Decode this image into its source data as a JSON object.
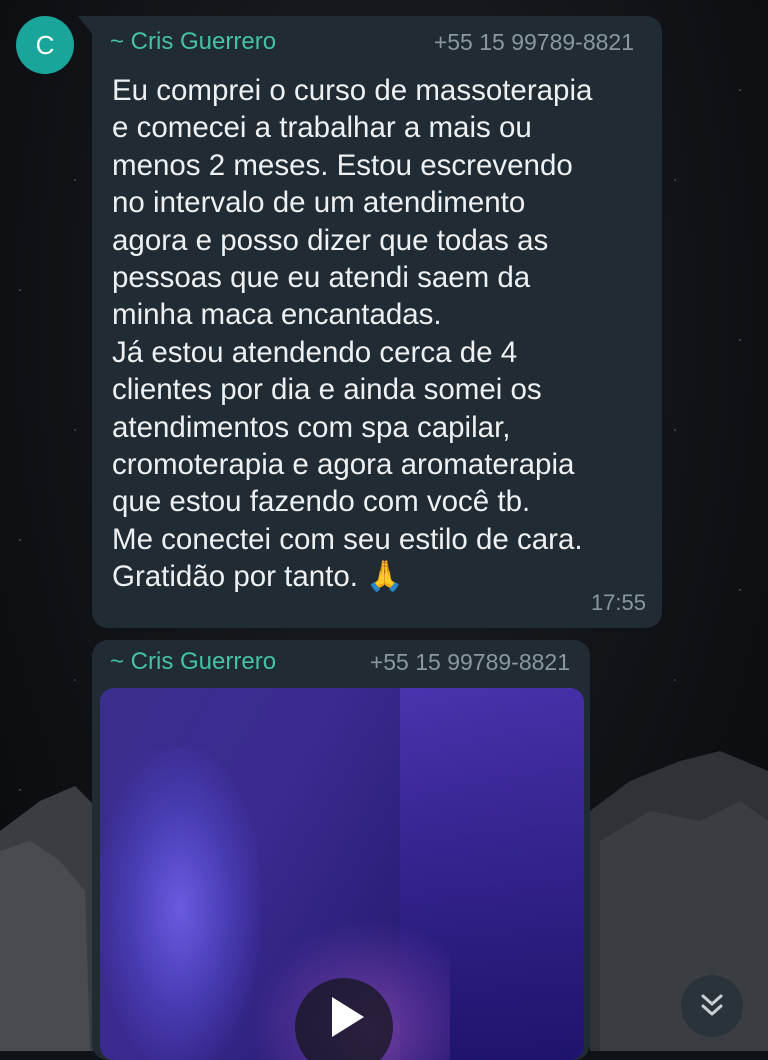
{
  "chat": {
    "avatar_initial": "C",
    "messages": [
      {
        "sender_name": "~ Cris Guerrero",
        "sender_phone": "+55 15 99789-8821",
        "text": "Eu comprei o curso de massoterapia\ne comecei a trabalhar a mais ou\nmenos 2 meses. Estou escrevendo\nno intervalo de um atendimento\nagora e posso dizer que todas as\npessoas que eu atendi saem da\nminha maca encantadas.\nJá estou atendendo cerca de 4\nclientes por dia e ainda somei os\natendimentos com spa capilar,\ncromoterapia e agora aromaterapia\nque estou fazendo com você tb.\nMe conectei com seu estilo de cara.\nGratidão por tanto. ",
        "emoji": "🙏",
        "time": "17:55"
      },
      {
        "sender_name": "~ Cris Guerrero",
        "sender_phone": "+55 15 99789-8821",
        "media_type": "video"
      }
    ]
  },
  "icons": {
    "play": "play-icon",
    "scroll_down": "double-chevron-down-icon"
  },
  "colors": {
    "bubble": "#202b33",
    "sender_name": "#45c1a4",
    "avatar": "#1aa59a",
    "meta_text": "#8b979e"
  }
}
